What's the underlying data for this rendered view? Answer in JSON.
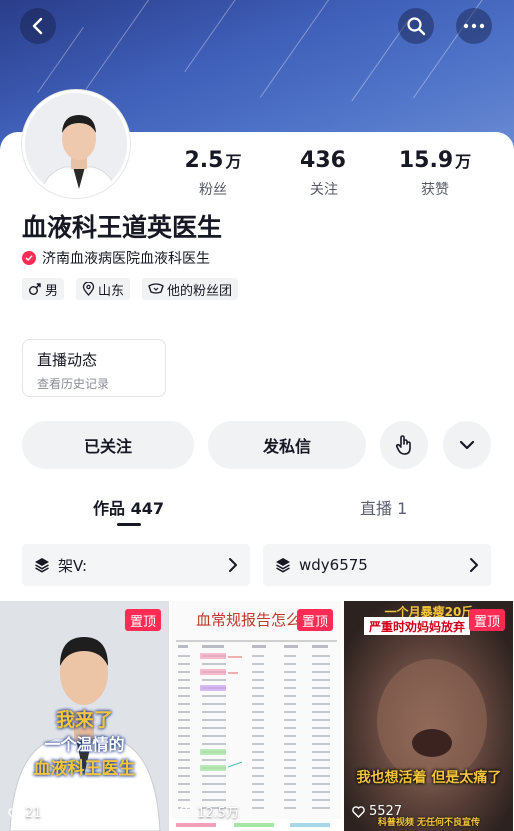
{
  "profile": {
    "name": "血液科王道英医生",
    "verify_text": "济南血液病医院血液科医生",
    "tags": [
      "男",
      "山东",
      "他的粉丝团"
    ]
  },
  "stats": [
    {
      "num": "2.5",
      "unit": "万",
      "label": "粉丝"
    },
    {
      "num": "436",
      "unit": "",
      "label": "关注"
    },
    {
      "num": "15.9",
      "unit": "万",
      "label": "获赞"
    }
  ],
  "live": {
    "title": "直播动态",
    "subtitle": "查看历史记录"
  },
  "actions": {
    "follow": "已关注",
    "message": "发私信"
  },
  "tabs": {
    "works": "作品 447",
    "live": "直播 1"
  },
  "chips": [
    "架V:",
    "wdy6575"
  ],
  "videos": [
    {
      "pin": "置顶",
      "count": "21",
      "caption_top": "我来了",
      "caption_mid": "一个温情的",
      "caption_bot": "血液科王医生"
    },
    {
      "pin": "置顶",
      "count": "12.5万",
      "header": "血常规报告怎么"
    },
    {
      "pin": "置顶",
      "count": "5527",
      "banner_top": "一个月暴瘦20斤",
      "banner": "严重时劝妈妈放弃",
      "caption": "我也想活着 但是太痛了",
      "footer": "科普视频 无任何不良宣传"
    }
  ],
  "colors": {
    "accent": "#fe2c55",
    "hero": "#3f5fb8"
  }
}
